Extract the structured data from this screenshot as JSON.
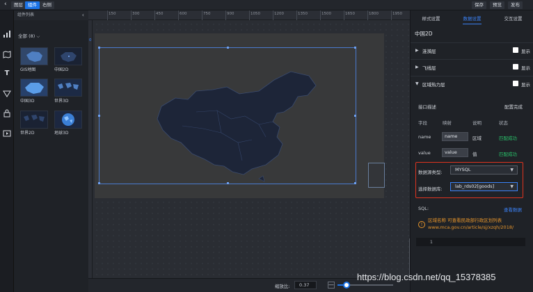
{
  "topbar": {
    "back_icon": "chevron-left-icon",
    "layers_label": "图层",
    "components_label": "组件",
    "right_panel_label": "右侧",
    "save_label": "保存",
    "preview_label": "预览",
    "publish_label": "发布"
  },
  "icon_strip": [
    "chart-icon",
    "map-icon",
    "text-icon",
    "filter-icon",
    "media-icon",
    "video-icon"
  ],
  "component_list": {
    "title": "组件列表",
    "filter": "全部 (8)",
    "items": [
      {
        "label": "GIS地图",
        "icon": "gis-map-thumb"
      },
      {
        "label": "中国2D",
        "icon": "china-2d-thumb"
      },
      {
        "label": "中国3D",
        "icon": "china-3d-thumb"
      },
      {
        "label": "世界3D",
        "icon": "world-3d-thumb"
      },
      {
        "label": "世界2D",
        "icon": "world-2d-thumb"
      },
      {
        "label": "地球3D",
        "icon": "globe-3d-thumb"
      }
    ]
  },
  "ruler": {
    "ticks": [
      "150",
      "300",
      "450",
      "600",
      "750",
      "900",
      "1050",
      "1200",
      "1350",
      "1500",
      "1650",
      "1800",
      "1950"
    ],
    "corner_number": "0"
  },
  "zoom": {
    "label": "缩放比:",
    "value": "0.37",
    "minus": "—",
    "level": 0.37
  },
  "right_panel": {
    "tabs": [
      "样式设置",
      "数据设置",
      "交互设置"
    ],
    "active_tab": 1,
    "component_title": "中国2D",
    "layers": [
      {
        "name": "涟漪层",
        "show": "显示",
        "collapsed": true
      },
      {
        "name": "飞线层",
        "show": "显示",
        "collapsed": true
      },
      {
        "name": "区域热力层",
        "show": "显示",
        "collapsed": false
      }
    ],
    "interface_desc": "接口描述",
    "config_done": "配置完成",
    "columns": [
      "字段",
      "映射",
      "说明",
      "状态"
    ],
    "fields": [
      {
        "field": "name",
        "mapping": "name",
        "desc": "区域",
        "status": "匹配成功"
      },
      {
        "field": "value",
        "mapping": "value",
        "desc": "值",
        "status": "匹配成功"
      }
    ],
    "datasource_type_label": "数据源类型:",
    "datasource_type_value": "MYSQL",
    "database_label": "选择数据库:",
    "database_value": "lab_rds02[goods]",
    "sql_label": "SQL:",
    "view_data": "查看数据",
    "warning_text": "区域名称 可查看民政部行政区划列表 www.mca.gov.cn/article/sj/xzqh/2018/",
    "sql_line_number": "1"
  },
  "watermark": "https://blog.csdn.net/qq_15378385",
  "colors": {
    "accent": "#1a73e8",
    "success": "#29c26a",
    "warning": "#e8962b",
    "highlight_box": "#e0341f"
  }
}
